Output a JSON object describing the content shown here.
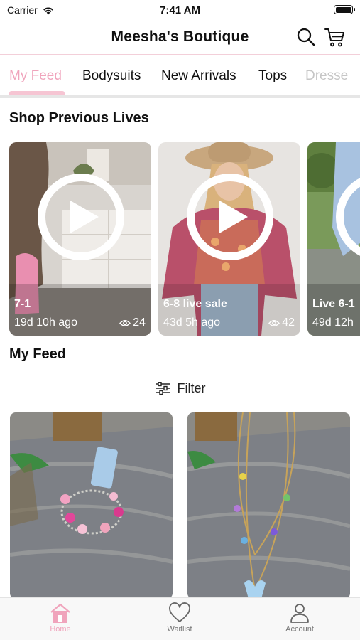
{
  "status_bar": {
    "carrier": "Carrier",
    "time": "7:41 AM"
  },
  "header": {
    "title": "Meesha's Boutique",
    "search_icon": "search-icon",
    "cart_icon": "cart-icon"
  },
  "tabs": [
    {
      "label": "My Feed",
      "active": true
    },
    {
      "label": "Bodysuits"
    },
    {
      "label": "New Arrivals"
    },
    {
      "label": "Tops"
    },
    {
      "label": "Dresse"
    }
  ],
  "lives_section": {
    "title": "Shop Previous Lives",
    "items": [
      {
        "name": "7-1",
        "ago": "19d 10h ago",
        "views": "24"
      },
      {
        "name": "6-8 live sale",
        "ago": "43d 5h ago",
        "views": "42"
      },
      {
        "name": "Live 6-1",
        "ago": "49d 12h"
      }
    ]
  },
  "feed_section": {
    "title": "My Feed",
    "filter_label": "Filter"
  },
  "bottom_nav": [
    {
      "label": "Home",
      "icon": "home-icon",
      "active": true
    },
    {
      "label": "Waitlist",
      "icon": "heart-icon"
    },
    {
      "label": "Account",
      "icon": "person-icon"
    }
  ],
  "colors": {
    "accent_pink": "#f0a4bc",
    "tab_indicator": "#f6c5d3",
    "header_border": "#f3cfd9"
  }
}
